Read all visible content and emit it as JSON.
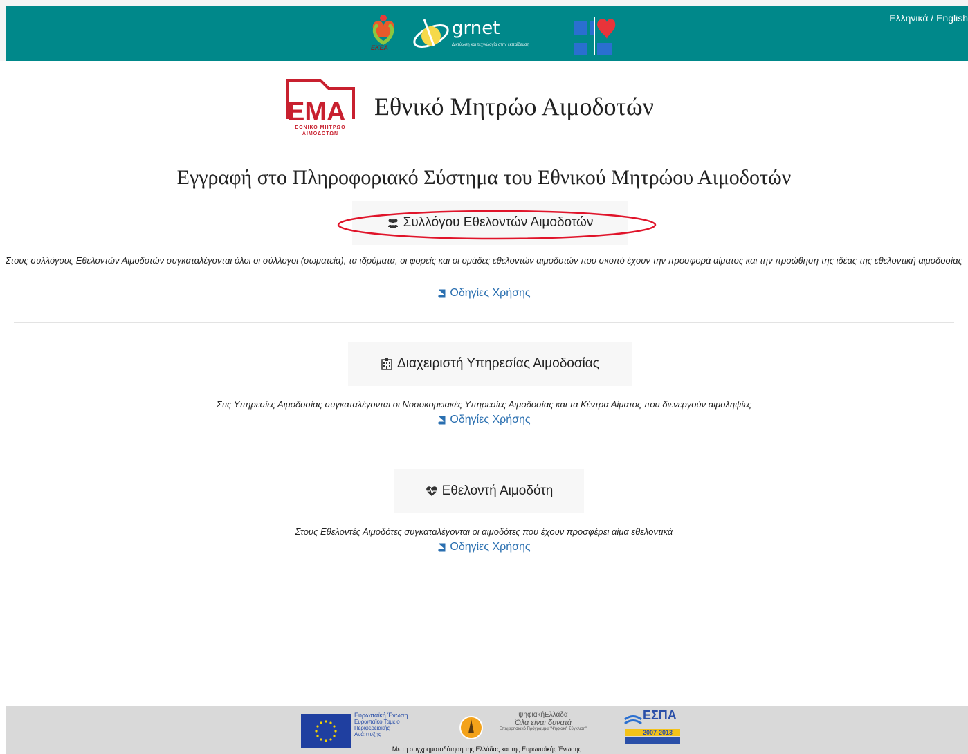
{
  "header": {
    "language_link": "Ελληνικά / English",
    "grnet_name": "grnet",
    "grnet_tagline": "Δικτύωση και τεχνολογία στην εκπαίδευση",
    "ekea_name": "ΕΚΕΑ"
  },
  "brand": {
    "logo_letters": "ΕΜΑ",
    "logo_subtitle": "ΕΘΝΙΚΟ ΜΗΤΡΩΟ ΑΙΜΟΔΟΤΩΝ",
    "title": "Εθνικό Μητρώο Αιμοδοτών"
  },
  "page_title": "Εγγραφή στο Πληροφοριακό Σύστημα του Εθνικού Μητρώου Αιμοδοτών",
  "roles": [
    {
      "label": "Συλλόγου Εθελοντών Αιμοδοτών",
      "icon": "users-icon",
      "description": "Στους συλλόγους Εθελοντών Αιμοδοτών συγκαταλέγονται όλοι οι σύλλογοι (σωματεία), τα ιδρύματα, οι φορείς και οι ομάδες εθελοντών αιμοδοτών που σκοπό έχουν την προσφορά αίματος και την προώθηση της ιδέας της εθελοντική αιμοδοσίας",
      "guide_label": "Οδηγίες Χρήσης"
    },
    {
      "label": "Διαχειριστή Υπηρεσίας Αιμοδοσίας",
      "icon": "hospital-icon",
      "description": "Στις Υπηρεσίες Αιμοδοσίας συγκαταλέγονται οι Νοσοκομειακές Υπηρεσίες Αιμοδοσίας και τα Κέντρα Αίματος που διενεργούν αιμοληψίες",
      "guide_label": "Οδηγίες Χρήσης"
    },
    {
      "label": "Εθελοντή Αιμοδότη",
      "icon": "heartbeat-icon",
      "description": "Στους Εθελοντές Αιμοδότες συγκαταλέγονται οι αιμοδότες που έχουν προσφέρει αίμα εθελοντικά",
      "guide_label": "Οδηγίες Χρήσης"
    }
  ],
  "footer": {
    "eu_text_1": "Ευρωπαϊκή Ένωση",
    "eu_text_2": "Ευρωπαϊκό Ταμείο Περιφερειακής Ανάπτυξης",
    "digital_title": "ψηφιακήΕλλάδα",
    "digital_slogan": "Όλα είναι δυνατά",
    "digital_sub": "Επιχειρησιακό Πρόγραμμα \"Ψηφιακή Σύγκλιση\"",
    "espa_name": "ΕΣΠΑ",
    "espa_years": "2007-2013",
    "funding_text": "Με τη συγχρηματοδότηση της Ελλάδας και της Ευρωπαϊκής Ένωσης"
  },
  "colors": {
    "header_bg": "#00888a",
    "link": "#2a6fb0",
    "ema_red": "#c8202f",
    "highlight_ellipse": "#e0142a",
    "footer_bg": "#d9d9d9"
  }
}
